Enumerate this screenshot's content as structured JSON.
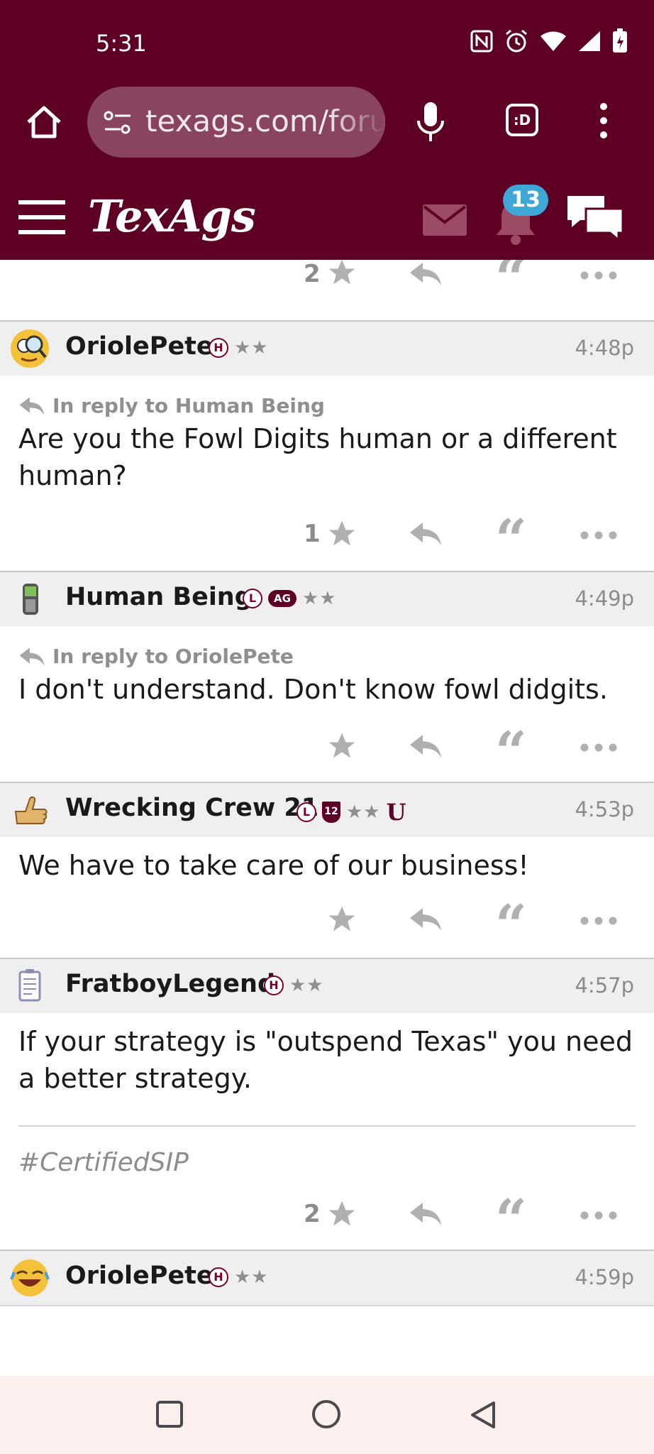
{
  "status_bar": {
    "time": "5:31"
  },
  "browser": {
    "url": "texags.com/forums/",
    "tabs_label": ":D"
  },
  "site": {
    "logo": "TexAgs",
    "notification_count": "13"
  },
  "feed": {
    "top_actions": {
      "star_count": "2"
    },
    "posts": [
      {
        "username": "OriolePete",
        "badge_h": "H",
        "stars": "★★",
        "time": "4:48p",
        "reply_to": "In reply to Human Being",
        "text": "Are you the Fowl Digits human or a different human?",
        "star_count": "1"
      },
      {
        "username": "Human Being",
        "badge_l": "L",
        "badge_ag": "AG",
        "stars": "★★",
        "time": "4:49p",
        "reply_to": "In reply to OriolePete",
        "text": "I don't understand. Don't know fowl didgits.",
        "star_count": ""
      },
      {
        "username": "Wrecking Crew 21",
        "badge_l": "L",
        "badge_12": "12",
        "stars": "★★",
        "badge_u": "U",
        "time": "4:53p",
        "text": "We have to take care of our business!",
        "star_count": ""
      },
      {
        "username": "FratboyLegend",
        "badge_h": "H",
        "stars": "★★",
        "time": "4:57p",
        "text": "If your strategy is \"outspend Texas\" you need a better strategy.",
        "signature": "#CertifiedSIP",
        "star_count": "2"
      },
      {
        "username": "OriolePete",
        "badge_h": "H",
        "stars": "★★",
        "time": "4:59p"
      }
    ]
  },
  "colors": {
    "maroon": "#5e0024",
    "badge_blue": "#3ea7d6",
    "action_gray": "#b0b0b0"
  },
  "icons": [
    "home-icon",
    "settings-icon",
    "mic-icon",
    "tabs-icon",
    "more-vert-icon",
    "menu-icon",
    "mail-icon",
    "bell-icon",
    "chat-icon",
    "star-icon",
    "reply-icon",
    "quote-icon",
    "more-horiz-icon"
  ]
}
